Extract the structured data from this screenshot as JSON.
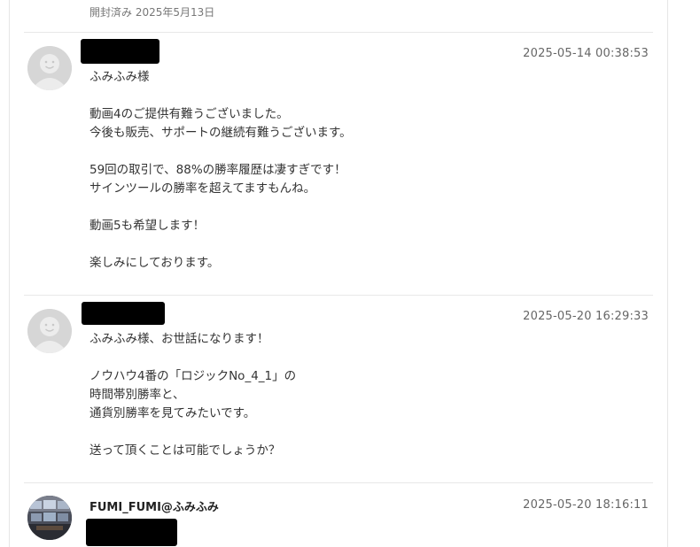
{
  "status": {
    "opened_label": "開封済み 2025年5月13日"
  },
  "messages": [
    {
      "timestamp": "2025-05-14 00:38:53",
      "lines": [
        "ふみふみ様",
        "",
        "動画4のご提供有難うございました。",
        "今後も販売、サポートの継続有難うございます。",
        "",
        "59回の取引で、88%の勝率履歴は凄すぎです！",
        "サインツールの勝率を超えてますもんね。",
        "",
        "動画5も希望します！",
        "",
        "楽しみにしております。"
      ]
    },
    {
      "timestamp": "2025-05-20 16:29:33",
      "lines": [
        "ふみふみ様、お世話になります！",
        "",
        "ノウハウ4番の「ロジックNo_4_1」の",
        "時間帯別勝率と、",
        "通貨別勝率を見てみたいです。",
        "",
        "送って頂くことは可能でしょうか？"
      ]
    },
    {
      "sender": "FUMI_FUMI@ふみふみ",
      "timestamp": "2025-05-20 18:16:11"
    }
  ],
  "icons": {
    "default_avatar": "user-silhouette-icon",
    "photo_avatar": "user-photo-avatar"
  },
  "colors": {
    "divider": "#e8e8e8",
    "avatar_default": "#d6d6d6",
    "redaction": "#000000"
  }
}
